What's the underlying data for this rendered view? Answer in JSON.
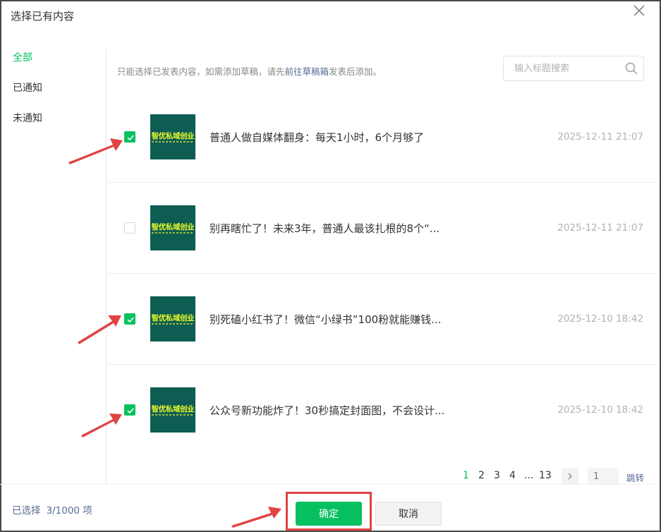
{
  "dialog": {
    "title": "选择已有内容"
  },
  "sidebar": {
    "items": [
      {
        "label": "全部",
        "active": true
      },
      {
        "label": "已通知",
        "active": false
      },
      {
        "label": "未通知",
        "active": false
      }
    ]
  },
  "notice": {
    "prefix": "只能选择已发表内容，如需添加草稿，请先",
    "link": "前往草稿箱",
    "suffix": "发表后添加。"
  },
  "search": {
    "placeholder": "输入标题搜索",
    "value": ""
  },
  "articles": [
    {
      "title": "普通人做自媒体翻身：每天1小时，6个月够了",
      "date": "2025-12-11 21:07",
      "checked": true,
      "thumb_text": "智优私域创业"
    },
    {
      "title": "别再瞎忙了！未来3年，普通人最该扎根的8个“...",
      "date": "2025-12-11 21:07",
      "checked": false,
      "thumb_text": "智优私域创业"
    },
    {
      "title": "别死磕小红书了！微信“小绿书”100粉就能赚钱...",
      "date": "2025-12-10 18:42",
      "checked": true,
      "thumb_text": "智优私域创业"
    },
    {
      "title": "公众号新功能炸了！30秒搞定封面图，不会设计...",
      "date": "2025-12-10 18:42",
      "checked": true,
      "thumb_text": "智优私域创业"
    }
  ],
  "pagination": {
    "pages": [
      "1",
      "2",
      "3",
      "4",
      "...",
      "13"
    ],
    "current": "1",
    "jump_input_placeholder": "1",
    "jump_label": "跳转"
  },
  "footer": {
    "selected_label": "已选择",
    "selected_value": "3/1000 项",
    "ok_label": "确定",
    "cancel_label": "取消"
  },
  "colors": {
    "accent": "#07c160",
    "link": "#576b95",
    "annotation": "#e04343",
    "thumb_bg": "#0d5d52",
    "thumb_text": "#e5f52a"
  }
}
